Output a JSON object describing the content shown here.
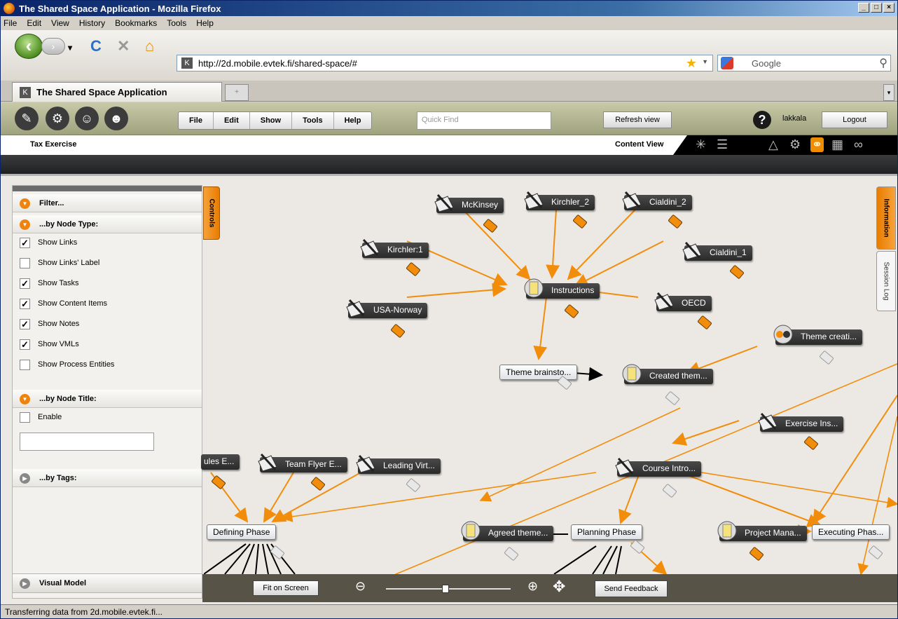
{
  "window": {
    "title": "The Shared Space Application - Mozilla Firefox"
  },
  "menubar": {
    "items": [
      "File",
      "Edit",
      "View",
      "History",
      "Bookmarks",
      "Tools",
      "Help"
    ]
  },
  "navbar": {
    "url": "http://2d.mobile.evtek.fi/shared-space/#",
    "search_placeholder": "Google"
  },
  "tabs": {
    "active_label": "The Shared Space Application"
  },
  "app": {
    "menu": [
      "File",
      "Edit",
      "Show",
      "Tools",
      "Help"
    ],
    "quick_find_placeholder": "Quick Find",
    "refresh_label": "Refresh view",
    "username": "lakkala",
    "logout_label": "Logout",
    "breadcrumb": "Tax Exercise",
    "view_label": "Content View"
  },
  "filter": {
    "header": "Filter...",
    "node_type_header": "...by Node Type:",
    "options": [
      {
        "label": "Show Links",
        "checked": true
      },
      {
        "label": "Show Links' Label",
        "checked": false
      },
      {
        "label": "Show Tasks",
        "checked": true
      },
      {
        "label": "Show Content Items",
        "checked": true
      },
      {
        "label": "Show Notes",
        "checked": true
      },
      {
        "label": "Show VMLs",
        "checked": true
      },
      {
        "label": "Show Process Entities",
        "checked": false
      }
    ],
    "node_title_header": "...by Node Title:",
    "enable_label": "Enable",
    "tags_header": "...by Tags:",
    "visual_model_label": "Visual Model"
  },
  "side_tabs": {
    "controls": "Controls",
    "information": "Information",
    "session_log": "Session Log"
  },
  "graph": {
    "nodes": [
      {
        "label": "McKinsey",
        "kind": "content"
      },
      {
        "label": "Kirchler_2",
        "kind": "content"
      },
      {
        "label": "Cialdini_2",
        "kind": "content"
      },
      {
        "label": "Kirchler:1",
        "kind": "content"
      },
      {
        "label": "Cialdini_1",
        "kind": "content"
      },
      {
        "label": "Instructions",
        "kind": "note"
      },
      {
        "label": "USA-Norway",
        "kind": "content"
      },
      {
        "label": "OECD",
        "kind": "content"
      },
      {
        "label": "Theme creati...",
        "kind": "group"
      },
      {
        "label": "Theme brainsto...",
        "kind": "task"
      },
      {
        "label": "Created them...",
        "kind": "note"
      },
      {
        "label": "Exercise Ins...",
        "kind": "content"
      },
      {
        "label": "ules E...",
        "kind": "content"
      },
      {
        "label": "Team Flyer E...",
        "kind": "content"
      },
      {
        "label": "Leading Virt...",
        "kind": "content"
      },
      {
        "label": "Course Intro...",
        "kind": "content"
      },
      {
        "label": "Defining Phase",
        "kind": "task"
      },
      {
        "label": "Agreed theme...",
        "kind": "note"
      },
      {
        "label": "Planning Phase",
        "kind": "task"
      },
      {
        "label": "Project Mana...",
        "kind": "note"
      },
      {
        "label": "Executing Phas...",
        "kind": "task"
      }
    ]
  },
  "bottom": {
    "fit_label": "Fit on Screen",
    "feedback_label": "Send Feedback",
    "zoom_level": 0.48
  },
  "status": {
    "text": "Transferring data from 2d.mobile.evtek.fi..."
  },
  "colors": {
    "link": "#f28d0c",
    "accent": "#f08c00",
    "toolbar": "#b5b792"
  }
}
